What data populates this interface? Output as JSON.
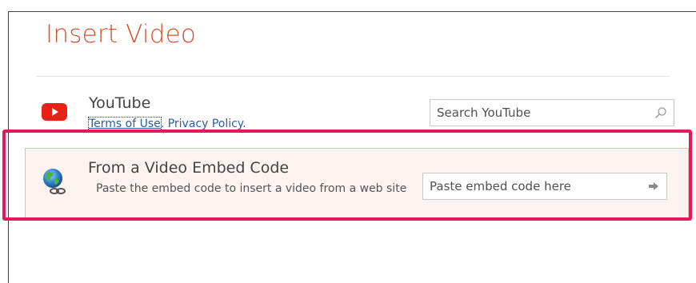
{
  "dialog": {
    "title": "Insert Video"
  },
  "youtube": {
    "title": "YouTube",
    "terms_link": "Terms of Use",
    "separator": ".",
    "privacy_link": "Privacy Policy.",
    "search_placeholder": "Search YouTube",
    "icon": "youtube-icon",
    "action_icon": "search-icon",
    "icon_color": "#e62117"
  },
  "embed": {
    "title": "From a Video Embed Code",
    "description": "Paste the embed code to insert a video from a web site",
    "input_placeholder": "Paste embed code here",
    "icon": "globe-link-icon",
    "action_icon": "arrow-right-icon"
  },
  "colors": {
    "title": "#d35230",
    "highlight": "#e8175d",
    "link": "#2a5caa"
  }
}
